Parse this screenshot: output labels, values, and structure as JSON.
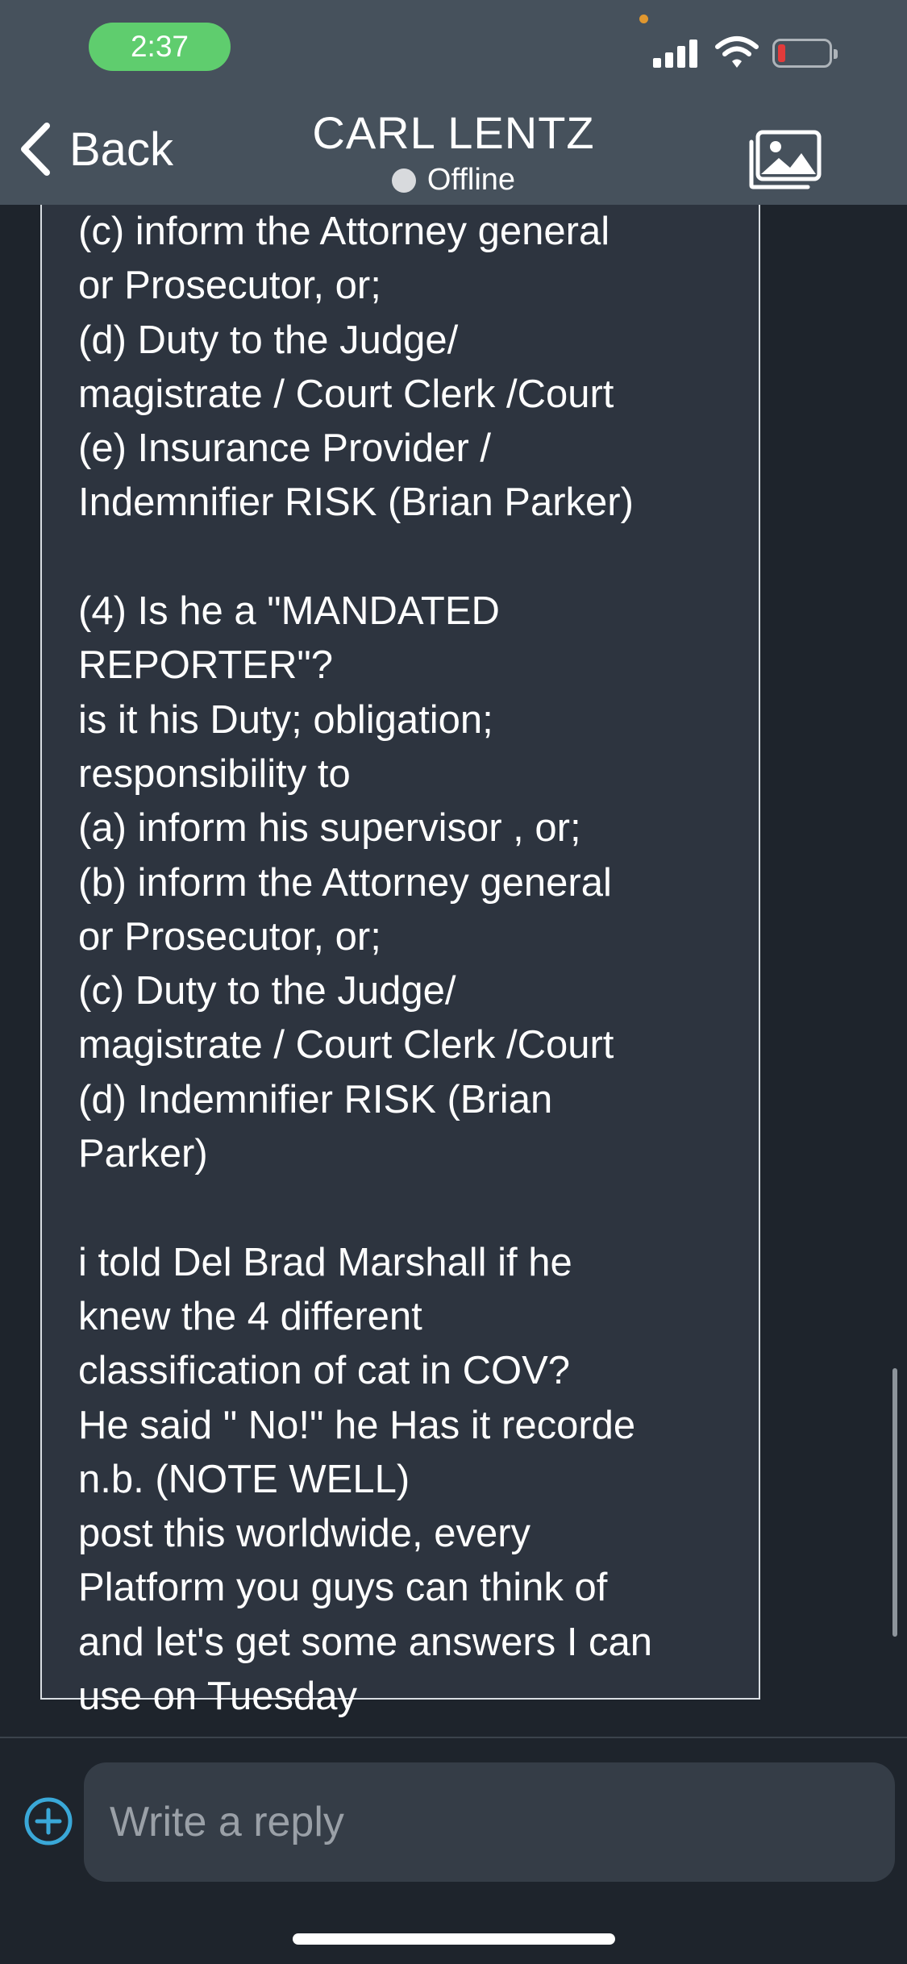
{
  "status_bar": {
    "time": "2:37"
  },
  "header": {
    "back_label": "Back",
    "title": "CARL LENTZ",
    "status": "Offline"
  },
  "message": {
    "text": "(c) inform the Attorney general\nor Prosecutor, or;\n(d) Duty to the Judge/\nmagistrate / Court Clerk /Court\n(e) Insurance Provider /\nIndemnifier RISK (Brian Parker)\n\n(4) Is he a \"MANDATED\nREPORTER\"?\nis it his Duty; obligation;\nresponsibility to\n(a) inform his supervisor , or;\n(b) inform the Attorney general\nor Prosecutor, or;\n(c) Duty to the Judge/\nmagistrate / Court Clerk /Court\n(d)  Indemnifier RISK (Brian\nParker)\n\ni told Del Brad Marshall if he\nknew the 4 different\nclassification of cat in COV?\nHe said \" No!\" he Has it recorde\nn.b. (NOTE WELL)\npost this worldwide, every\nPlatform you guys can think of\nand let's get some answers I can\nuse on Tuesday"
  },
  "composer": {
    "placeholder": "Write a reply"
  },
  "colors": {
    "header_bg": "#46515c",
    "screen_bg": "#1e242c",
    "bubble_bg": "#2d343f",
    "time_pill": "#5fcd6e",
    "accent": "#3aa8d8",
    "battery_low": "#e23b3b"
  },
  "icons": {
    "back": "chevron-left-icon",
    "gallery": "gallery-icon",
    "add": "plus-circle-icon"
  }
}
